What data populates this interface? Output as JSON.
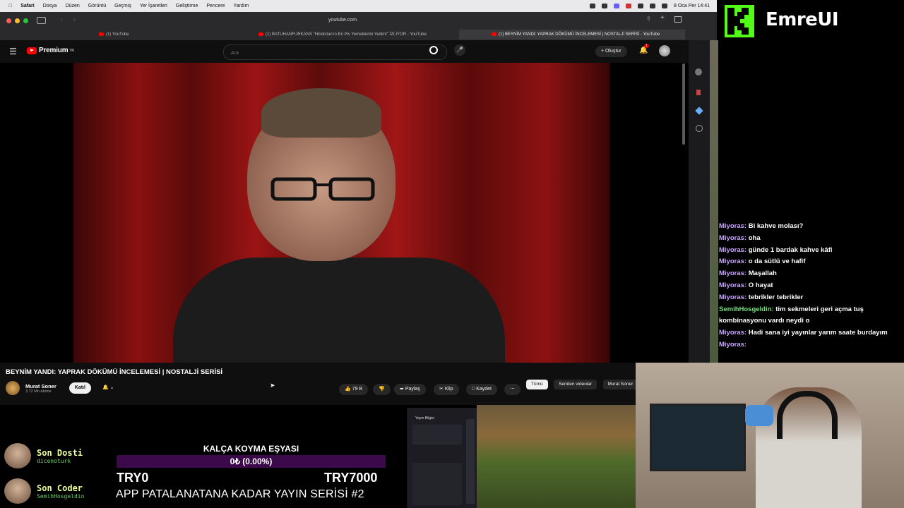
{
  "menubar": {
    "app": "Safari",
    "items": [
      "Dosya",
      "Düzen",
      "Görüntü",
      "Geçmiş",
      "Yer İşaretleri",
      "Geliştirme",
      "Pencere",
      "Yardım"
    ],
    "clock": "8 Oca Per 14:41"
  },
  "browser": {
    "url": "youtube.com",
    "tabs": [
      "(1) YouTube",
      "(1) BATUHANFURKANS \"Hindistan'ın En Pis Yemeklerini Yedim!\" İZLİYOR - YouTube",
      "(1) BEYNİM YANDI: YAPRAK DÖKÜMÜ İNCELEMESİ | NOSTALJİ SERİSİ - YouTube"
    ]
  },
  "youtube": {
    "logo": "Premium",
    "region": "TR",
    "search_placeholder": "Ara",
    "create_label": "Oluştur",
    "notif_count": "1",
    "video_title": "BEYNİM YANDI: YAPRAK DÖKÜMÜ İNCELEMESİ | NOSTALJİ SERİSİ",
    "channel_name": "Murat Soner",
    "subscribers": "3,72 Mn abone",
    "join_label": "Katıl",
    "likes": "79 B",
    "share_label": "Paylaş",
    "clip_label": "Klip",
    "save_label": "Kaydet",
    "chips": [
      "Tümü",
      "Seriden videolar",
      "Murat Soner"
    ]
  },
  "brand": {
    "name": "EmreUI",
    "accent": "#53fc18"
  },
  "chat": [
    {
      "user": "Miyoras:",
      "text": "Bi kahve molası?",
      "color": "purple"
    },
    {
      "user": "Miyoras:",
      "text": "oha",
      "color": "purple"
    },
    {
      "user": "Miyoras:",
      "text": "günde 1 bardak kahve kâfi",
      "color": "purple"
    },
    {
      "user": "Miyoras:",
      "text": "o da sütlü ve hafif",
      "color": "purple"
    },
    {
      "user": "Miyoras:",
      "text": "Maşallah",
      "color": "purple"
    },
    {
      "user": "Miyoras:",
      "text": "O hayat",
      "color": "purple"
    },
    {
      "user": "Miyoras:",
      "text": "tebrikler tebrikler",
      "color": "purple"
    },
    {
      "user": "SemihHosgeldin:",
      "text": "tim sekmeleri geri açma tuş kombinasyonu vardı neydi o",
      "color": "green"
    },
    {
      "user": "Miyoras:",
      "text": "Hadi sana iyi yayınlar yarım saate burdayım",
      "color": "purple"
    },
    {
      "user": "Miyoras:",
      "text": "",
      "color": "purple"
    }
  ],
  "supporters": [
    {
      "title": "Son Dosti",
      "name": "dicenoturk"
    },
    {
      "title": "Son Coder",
      "name": "SemihHosgeldin"
    }
  ],
  "goal": {
    "title": "KALÇA KOYMA EŞYASI",
    "progress_text": "0₺ (0.00%)",
    "progress": 0.0,
    "min_label": "TRY0",
    "max_label": "TRY7000",
    "series": "APP PATALANATANA KADAR YAYIN SERİSİ #2"
  },
  "obs": {
    "title": "Yayın Bilgisi"
  }
}
